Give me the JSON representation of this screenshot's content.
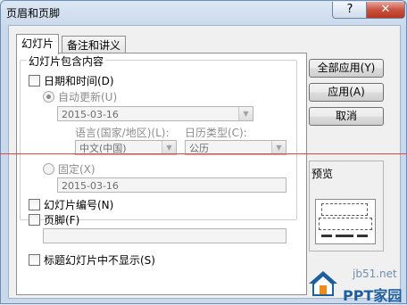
{
  "window": {
    "title": "页眉和页脚",
    "help": "?",
    "close": "✕"
  },
  "tabs": [
    {
      "label": "幻灯片",
      "active": true
    },
    {
      "label": "备注和讲义",
      "active": false
    }
  ],
  "group": {
    "label": "幻灯片包含内容"
  },
  "date_time": {
    "label": "日期和时间(D)",
    "checked": false
  },
  "auto_update": {
    "label": "自动更新(U)",
    "selected": true
  },
  "auto_date": {
    "value": "2015-03-16"
  },
  "language": {
    "label": "语言(国家/地区)(L):",
    "value": "中文(中国)"
  },
  "calendar": {
    "label": "日历类型(C):",
    "value": "公历"
  },
  "fixed": {
    "label": "固定(X)",
    "selected": false,
    "value": "2015-03-16"
  },
  "slide_number": {
    "label": "幻灯片编号(N)",
    "checked": false
  },
  "footer": {
    "label": "页脚(F)",
    "checked": false,
    "value": ""
  },
  "title_hide": {
    "label": "标题幻灯片中不显示(S)",
    "checked": false
  },
  "buttons": {
    "apply_all": "全部应用(Y)",
    "apply": "应用(A)",
    "cancel": "取消"
  },
  "preview": {
    "label": "预览"
  },
  "watermark": {
    "site": "jb51.net",
    "brand": "PPT家园"
  },
  "colors": {
    "accent": "#1d5f9e",
    "red_line": "#e04848"
  }
}
